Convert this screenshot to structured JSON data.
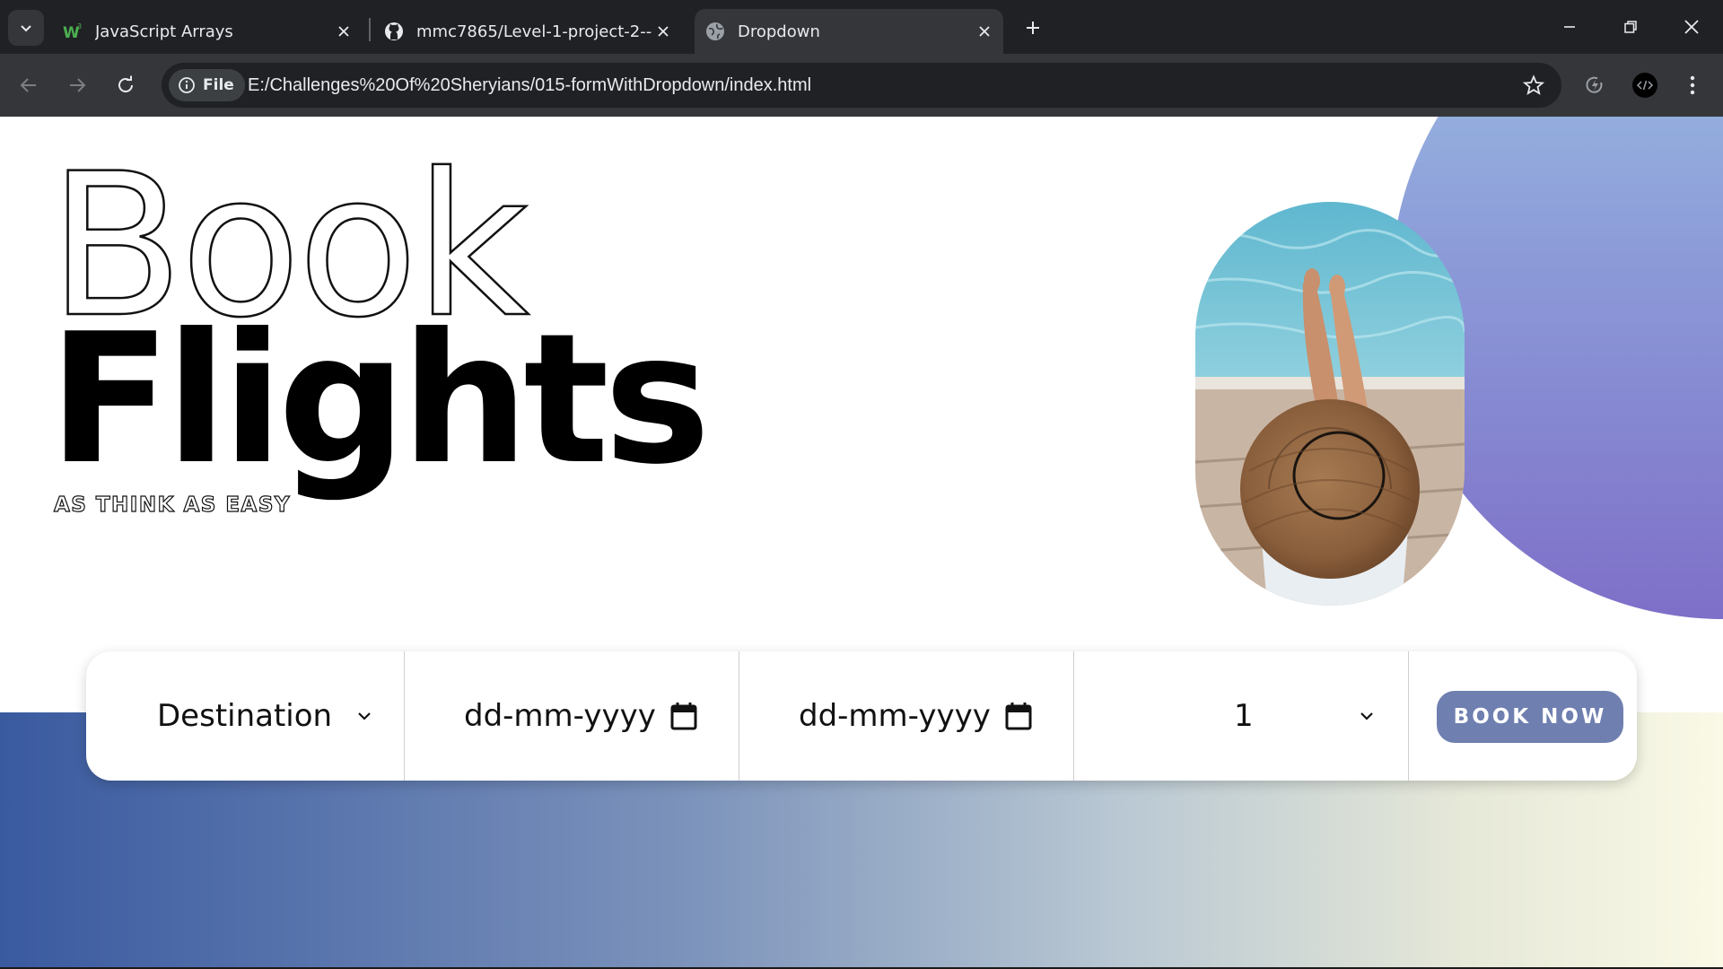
{
  "browser": {
    "tabs": [
      {
        "title": "JavaScript Arrays",
        "favicon": "w3schools-icon",
        "active": false
      },
      {
        "title": "mmc7865/Level-1-project-2---",
        "favicon": "github-icon",
        "active": false
      },
      {
        "title": "Dropdown",
        "favicon": "globe-icon",
        "active": true
      }
    ],
    "address": {
      "chip_label": "File",
      "url": "E:/Challenges%20Of%20Sheryians/015-formWithDropdown/index.html"
    }
  },
  "hero": {
    "title_outline": "Book",
    "title_bold": "Flights",
    "tagline": "AS THINK AS EASY"
  },
  "booking_form": {
    "destination": {
      "value": "Destination"
    },
    "depart_date": {
      "placeholder": "dd-mm-yyyy"
    },
    "return_date": {
      "placeholder": "dd-mm-yyyy"
    },
    "passengers": {
      "value": "1"
    },
    "submit_label": "BOOK NOW"
  },
  "colors": {
    "accent_button": "#6f7fb0",
    "circle_top": "#9cc3e4",
    "circle_bottom": "#7e6fc8",
    "band_left": "#3a5aa0",
    "band_right": "#faf9e6"
  }
}
